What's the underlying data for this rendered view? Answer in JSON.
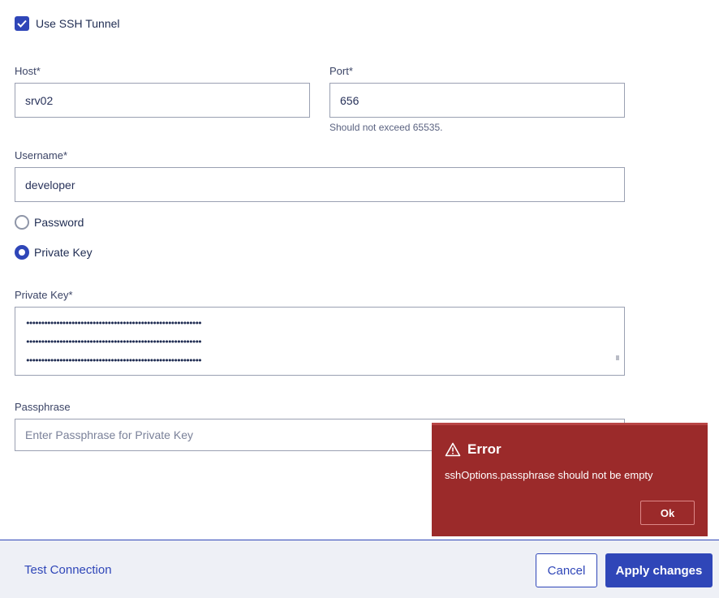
{
  "ssh": {
    "label": "Use SSH Tunnel",
    "checked": true
  },
  "host": {
    "label": "Host*",
    "value": "srv02"
  },
  "port": {
    "label": "Port*",
    "value": "656",
    "hint": "Should not exceed 65535."
  },
  "username": {
    "label": "Username*",
    "value": "developer"
  },
  "auth": {
    "password_label": "Password",
    "private_key_label": "Private Key",
    "selected": "Private Key"
  },
  "private_key": {
    "label": "Private Key*",
    "lines": [
      "••••••••••••••••••••••••••••••••••••••••••••••••••••••••••",
      "••••••••••••••••••••••••••••••••••••••••••••••••••••••••••",
      "••••••••••••••••••••••••••••••••••••••••••••••••••••••••••"
    ]
  },
  "passphrase": {
    "label": "Passphrase",
    "placeholder": "Enter Passphrase for Private Key",
    "value": ""
  },
  "footer": {
    "test_label": "Test Connection",
    "cancel_label": "Cancel",
    "apply_label": "Apply changes"
  },
  "error": {
    "title": "Error",
    "message": "sshOptions.passphrase should not be empty",
    "ok_label": "Ok"
  },
  "colors": {
    "accent": "#2f46b8",
    "error_bg": "#9b2a2a",
    "footer_bg": "#eef0f6"
  }
}
